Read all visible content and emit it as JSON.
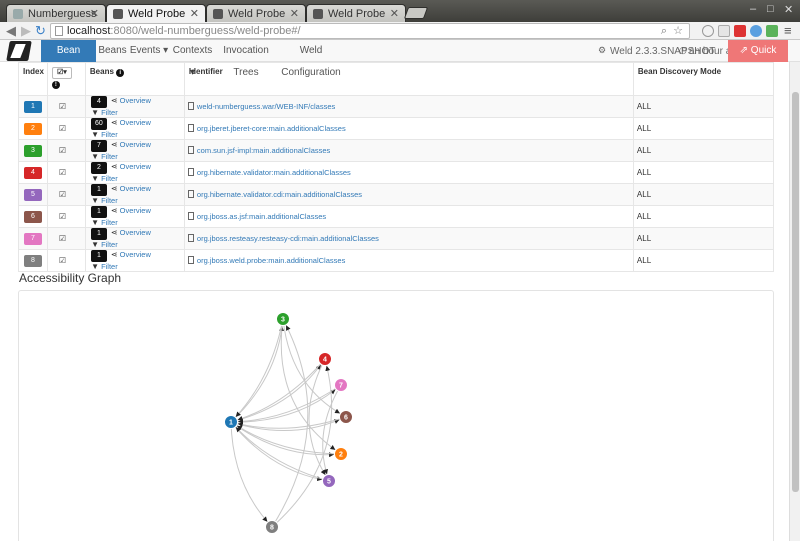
{
  "browser": {
    "tabs": [
      {
        "title": "Numberguess",
        "active": false
      },
      {
        "title": "Weld Probe",
        "active": true
      },
      {
        "title": "Weld Probe",
        "active": false
      },
      {
        "title": "Weld Probe",
        "active": false
      }
    ],
    "url_host": "localhost",
    "url_path": ":8080/weld-numberguess/weld-probe#/"
  },
  "nav": {
    "items": [
      "Bean Archives",
      "Beans",
      "Events ▾",
      "Contexts ▾",
      "Invocation Trees",
      "Weld Configuration"
    ],
    "version": "Weld 2.3.3.SNAPSHOT",
    "ago": "an hour ago",
    "quick_links": "Quick Links ▾"
  },
  "table": {
    "headers": {
      "index": "Index",
      "beans": "Beans",
      "identifier": "Identifier",
      "mode": "Bean Discovery Mode"
    },
    "overview_label": "Overview",
    "filter_label": "Filter",
    "rows": [
      {
        "index": "1",
        "color": "#1f77b4",
        "beans": "4",
        "identifier": "weld-numberguess.war/WEB-INF/classes",
        "mode": "ALL"
      },
      {
        "index": "2",
        "color": "#ff7f0e",
        "beans": "60",
        "identifier": "org.jberet.jberet-core:main.additionalClasses",
        "mode": "ALL"
      },
      {
        "index": "3",
        "color": "#2ca02c",
        "beans": "7",
        "identifier": "com.sun.jsf-impl:main.additionalClasses",
        "mode": "ALL"
      },
      {
        "index": "4",
        "color": "#d62728",
        "beans": "2",
        "identifier": "org.hibernate.validator:main.additionalClasses",
        "mode": "ALL"
      },
      {
        "index": "5",
        "color": "#9467bd",
        "beans": "1",
        "identifier": "org.hibernate.validator.cdi:main.additionalClasses",
        "mode": "ALL"
      },
      {
        "index": "6",
        "color": "#8c564b",
        "beans": "1",
        "identifier": "org.jboss.as.jsf:main.additionalClasses",
        "mode": "ALL"
      },
      {
        "index": "7",
        "color": "#e377c2",
        "beans": "1",
        "identifier": "org.jboss.resteasy.resteasy-cdi:main.additionalClasses",
        "mode": "ALL"
      },
      {
        "index": "8",
        "color": "#7f7f7f",
        "beans": "1",
        "identifier": "org.jboss.weld.probe:main.additionalClasses",
        "mode": "ALL"
      }
    ]
  },
  "graph": {
    "title": "Accessibility Graph",
    "nodes": [
      {
        "id": "1",
        "color": "#1f77b4"
      },
      {
        "id": "2",
        "color": "#ff7f0e"
      },
      {
        "id": "3",
        "color": "#2ca02c"
      },
      {
        "id": "4",
        "color": "#d62728"
      },
      {
        "id": "5",
        "color": "#9467bd"
      },
      {
        "id": "6",
        "color": "#8c564b"
      },
      {
        "id": "7",
        "color": "#e377c2"
      },
      {
        "id": "8",
        "color": "#7f7f7f"
      }
    ]
  }
}
